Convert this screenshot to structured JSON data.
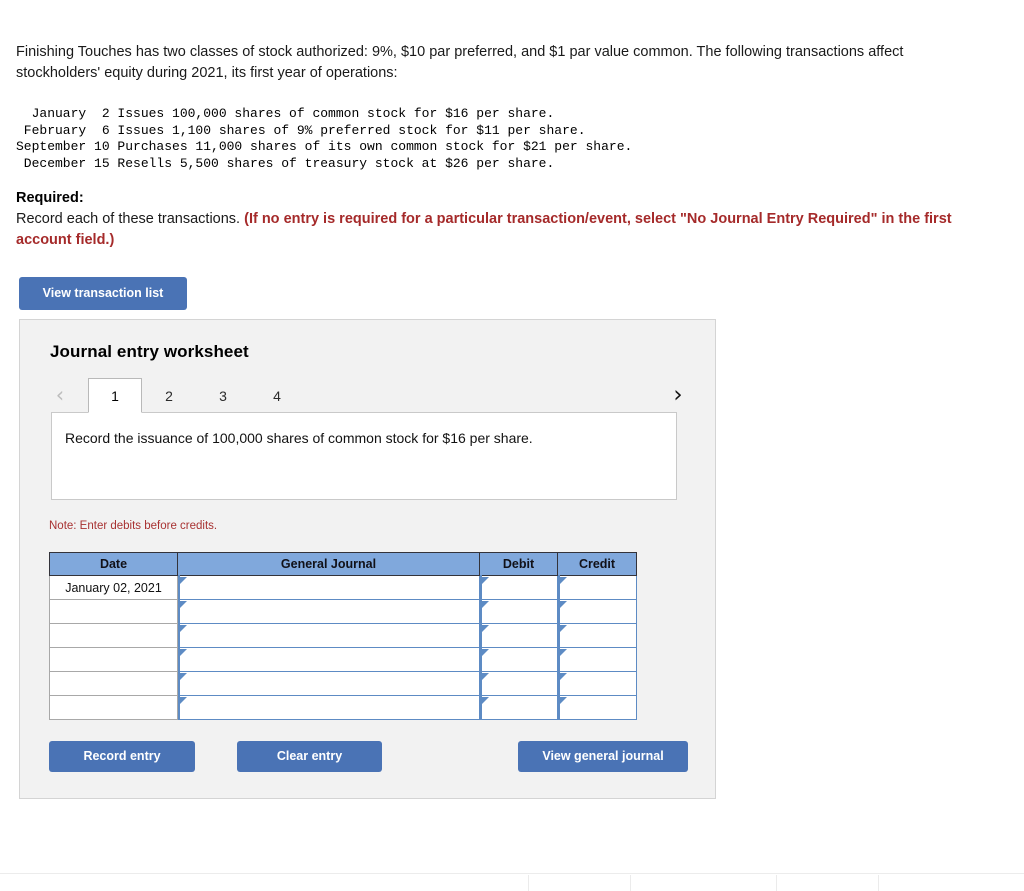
{
  "problem": {
    "statement": "Finishing Touches has two classes of stock authorized: 9%, $10 par preferred, and $1 par value common. The following transactions affect stockholders' equity during 2021, its first year of operations:",
    "transactions_block": "  January  2 Issues 100,000 shares of common stock for $16 per share.\n February  6 Issues 1,100 shares of 9% preferred stock for $11 per share.\nSeptember 10 Purchases 11,000 shares of its own common stock for $21 per share.\n December 15 Resells 5,500 shares of treasury stock at $26 per share."
  },
  "required": {
    "label": "Required:",
    "body": "Record each of these transactions. ",
    "emphasis": "(If no entry is required for a particular transaction/event, select \"No Journal Entry Required\" in the first account field.)"
  },
  "actions": {
    "view_transaction_list": "View transaction list",
    "record_entry": "Record entry",
    "clear_entry": "Clear entry",
    "view_general_journal": "View general journal"
  },
  "worksheet": {
    "title": "Journal entry worksheet",
    "prev_glyph": "‹",
    "next_glyph": "›",
    "tabs": [
      {
        "label": "1",
        "active": true
      },
      {
        "label": "2",
        "active": false
      },
      {
        "label": "3",
        "active": false
      },
      {
        "label": "4",
        "active": false
      }
    ],
    "prompt": "Record the issuance of 100,000 shares of common stock for $16 per share.",
    "note": "Note: Enter debits before credits."
  },
  "journal_table": {
    "columns": [
      "Date",
      "General Journal",
      "Debit",
      "Credit"
    ],
    "rows": [
      {
        "date": "January 02, 2021",
        "general_journal": "",
        "debit": "",
        "credit": ""
      },
      {
        "date": "",
        "general_journal": "",
        "debit": "",
        "credit": ""
      },
      {
        "date": "",
        "general_journal": "",
        "debit": "",
        "credit": ""
      },
      {
        "date": "",
        "general_journal": "",
        "debit": "",
        "credit": ""
      },
      {
        "date": "",
        "general_journal": "",
        "debit": "",
        "credit": ""
      },
      {
        "date": "",
        "general_journal": "",
        "debit": "",
        "credit": ""
      }
    ]
  },
  "colors": {
    "primary_button": "#4a73b5",
    "table_header": "#80a8dc",
    "note_red": "#a83232",
    "emphasis_red": "#a52a2a",
    "panel_bg": "#f2f2f2"
  },
  "footer": {
    "divider_positions": [
      528,
      630,
      776,
      878
    ]
  }
}
